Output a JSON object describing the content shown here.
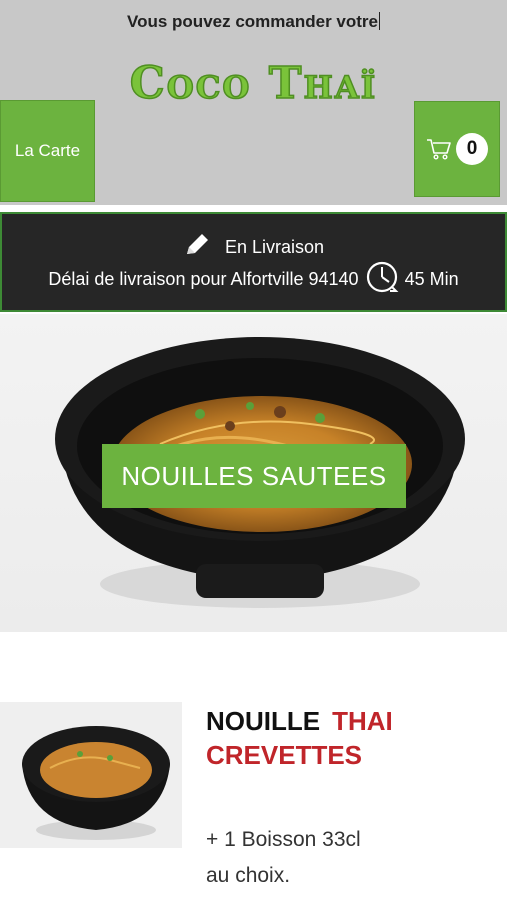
{
  "header": {
    "marquee_text": "Vous pouvez commander votre",
    "logo_text": "Coco Thaï",
    "menu_button_label": "La Carte",
    "cart_icon": "cart-icon",
    "cart_count": "0",
    "bg_color": "#c8c8c8",
    "accent_color": "#6cb33f"
  },
  "delivery": {
    "mode_icon": "pencil-icon",
    "mode_label": "En Livraison",
    "delay_label": "Délai de livraison pour Alfortville 94140",
    "clock_icon": "clock-icon",
    "delay_value": "45 Min"
  },
  "hero": {
    "category_title": "NOUILLES SAUTEES"
  },
  "product": {
    "title_word1": "NOUILLE",
    "title_word2": "THAI",
    "title_word3": "CREVETTES",
    "description_line1": "+ 1 Boisson 33cl",
    "description_line2": "au choix.",
    "title_accent_color": "#c0252a"
  }
}
